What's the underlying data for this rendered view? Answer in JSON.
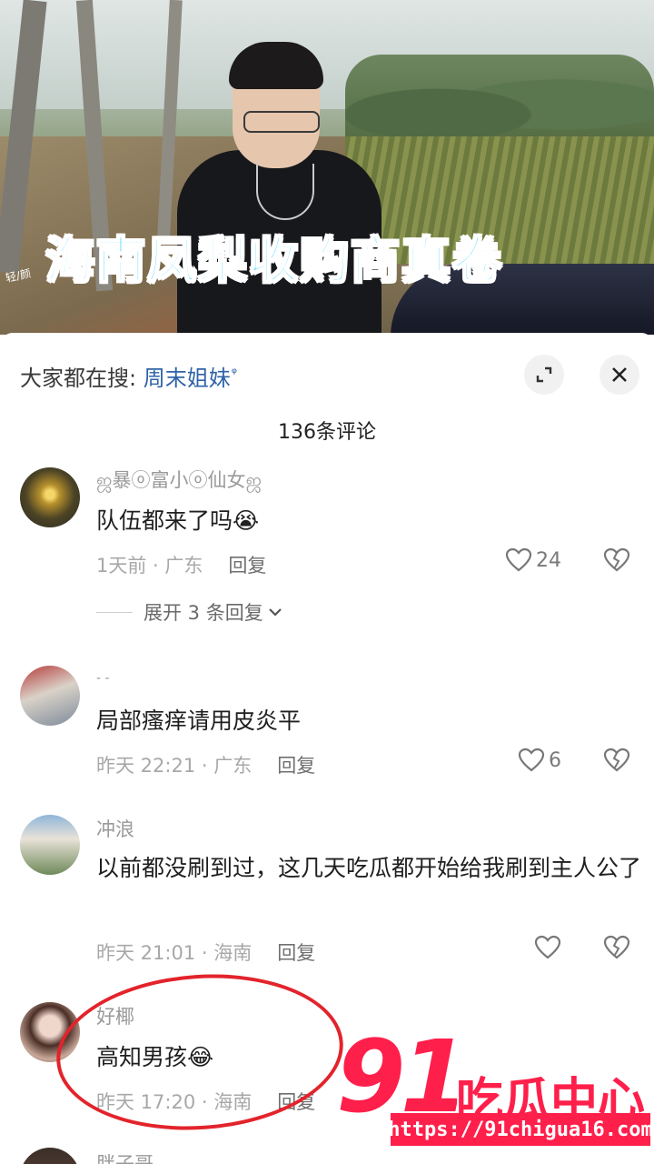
{
  "video": {
    "overlay_title": "海南凤梨收购商真卷",
    "small_watermark": "轻/颜"
  },
  "search": {
    "prefix": "大家都在搜:",
    "keyword": "周末姐妹",
    "search_glyph": "ᵠ"
  },
  "comment_count": "136条评论",
  "comments": [
    {
      "nickname": "ஜ暴ⓞ富小ⓞ仙女ஜ",
      "text": "队伍都来了吗😭",
      "time_location": "1天前 · 广东",
      "reply_label": "回复",
      "likes": "24",
      "expand_replies": "展开 3 条回复"
    },
    {
      "nickname": "- -",
      "text": "局部瘙痒请用皮炎平",
      "time_location": "昨天 22:21 · 广东",
      "reply_label": "回复",
      "likes": "6"
    },
    {
      "nickname": "冲浪",
      "text": "以前都没刷到过，这几天吃瓜都开始给我刷到主人公了",
      "time_location": "昨天 21:01 · 海南",
      "reply_label": "回复",
      "likes": ""
    },
    {
      "nickname": "好椰",
      "text": "高知男孩😂",
      "time_location": "昨天 17:20 · 海南",
      "reply_label": "回复"
    },
    {
      "nickname": "胖子哥"
    }
  ],
  "watermark": {
    "number": "91",
    "name": "吃瓜中心",
    "url": "https://91chigua16.com"
  },
  "colors": {
    "overlay_title": "#3ad4ff",
    "search_keyword": "#2f63a8",
    "annotation_red": "#e3232b",
    "watermark_red": "#ff1f4b"
  }
}
